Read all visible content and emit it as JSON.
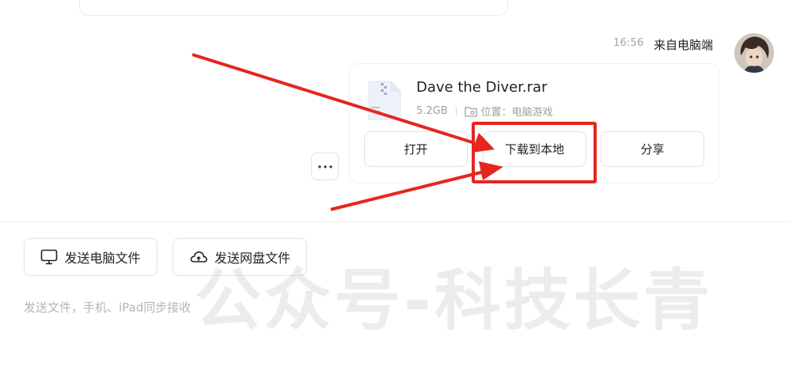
{
  "message": {
    "time": "16:56",
    "sender": "来自电脑端"
  },
  "file": {
    "name": "Dave the Diver.rar",
    "size": "5.2GB",
    "location": "位置：电脑游戏",
    "actions": {
      "open": "打开",
      "download": "下载到本地",
      "share": "分享"
    }
  },
  "more_button": "⋯",
  "compose": {
    "send_pc_files": "发送电脑文件",
    "send_cloud_files": "发送网盘文件",
    "hint": "发送文件，手机、iPad同步接收"
  },
  "watermark": "公众号-科技长青",
  "icons": {
    "file": "archive-file-icon",
    "folder": "folder-location-icon",
    "monitor": "monitor-icon",
    "cloud": "cloud-icon"
  },
  "colors": {
    "annotation": "#e5261f",
    "border": "#e3e3e3",
    "muted_text": "#a0a0a0"
  }
}
